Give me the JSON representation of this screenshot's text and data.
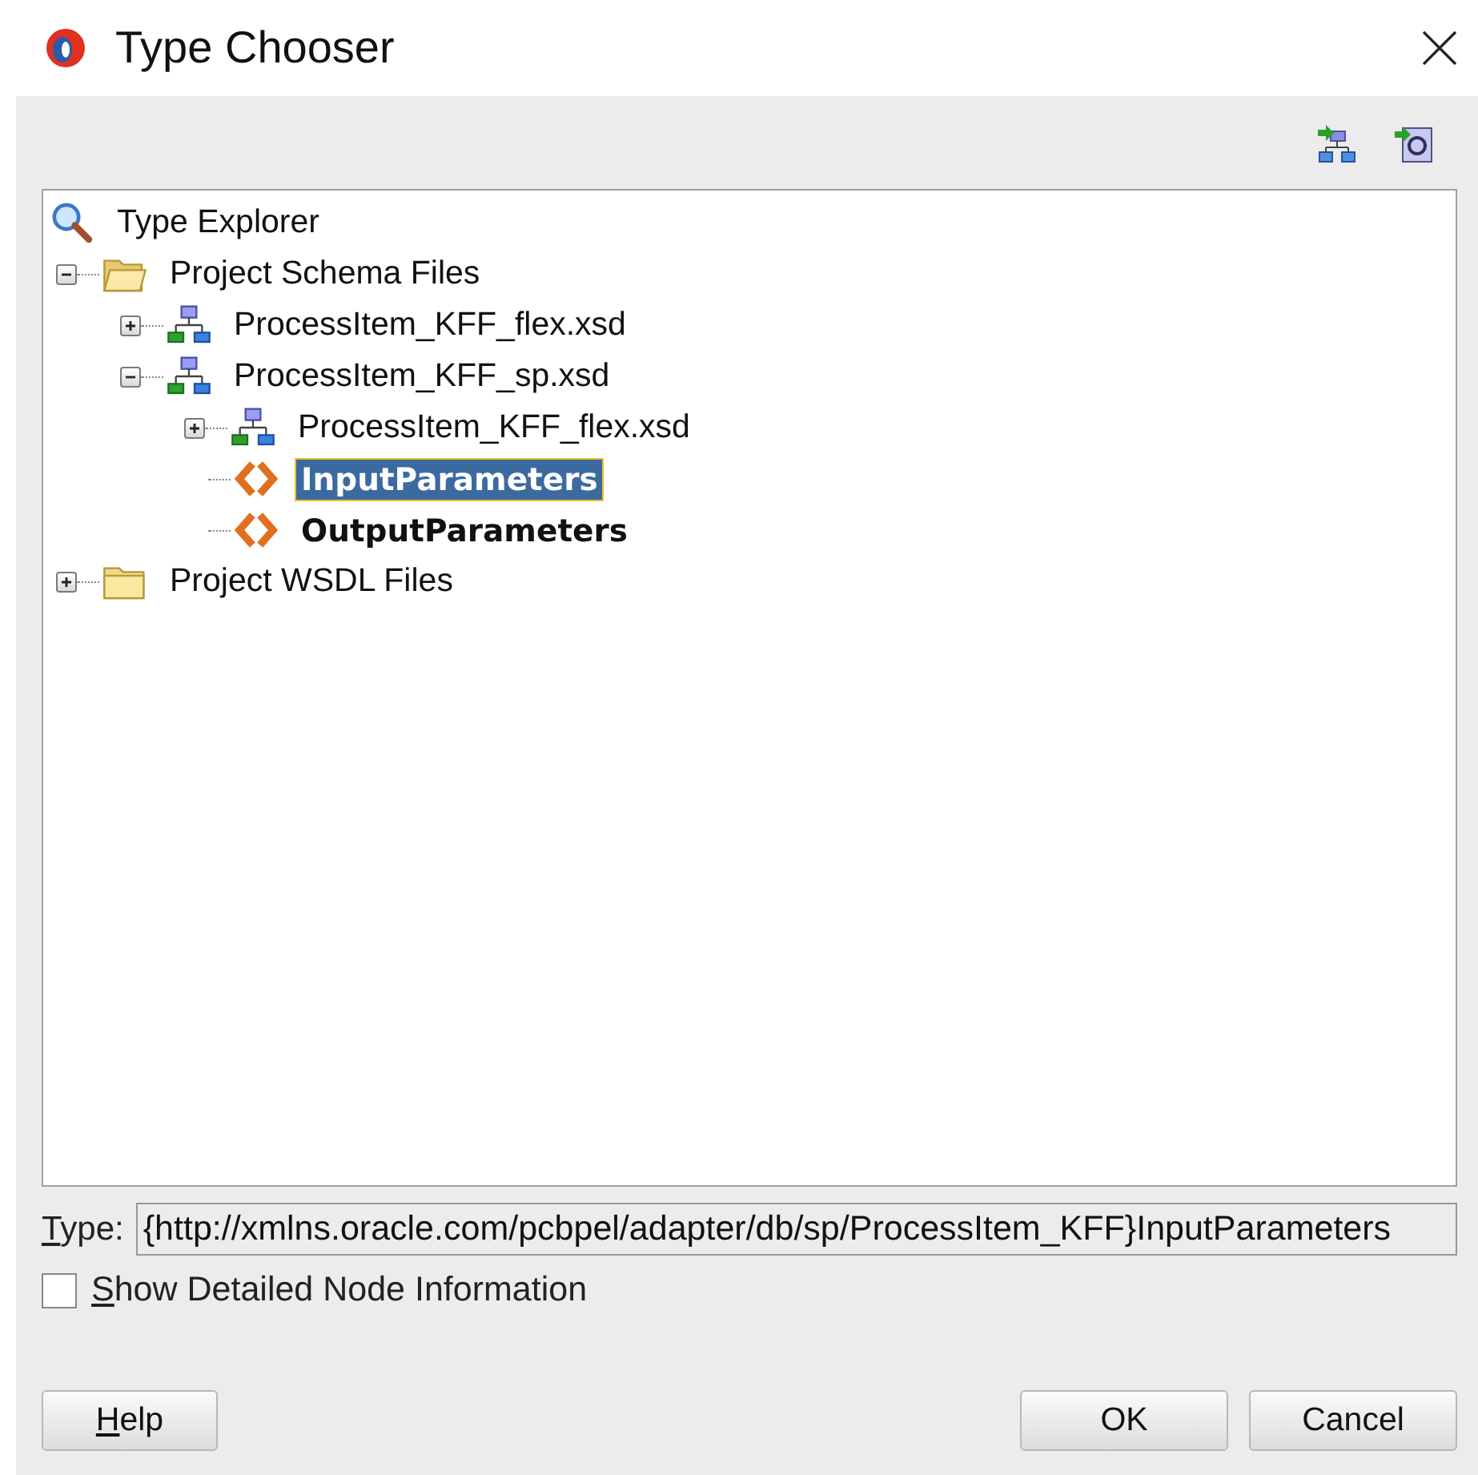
{
  "window": {
    "title": "Type Chooser"
  },
  "tree": [
    {
      "kind": "search",
      "label": "Type Explorer",
      "children": [
        {
          "kind": "folder",
          "label": "Project Schema Files",
          "expanded": true,
          "children": [
            {
              "kind": "schema",
              "label": "ProcessItem_KFF_flex.xsd",
              "expanded": false
            },
            {
              "kind": "schema",
              "label": "ProcessItem_KFF_sp.xsd",
              "expanded": true,
              "children": [
                {
                  "kind": "schema",
                  "label": "ProcessItem_KFF_flex.xsd",
                  "expanded": false
                },
                {
                  "kind": "element",
                  "label": "InputParameters",
                  "bold": true,
                  "selected": true
                },
                {
                  "kind": "element",
                  "label": "OutputParameters",
                  "bold": true,
                  "selected": false
                }
              ]
            }
          ]
        },
        {
          "kind": "folder",
          "label": "Project WSDL Files",
          "expanded": false
        }
      ]
    }
  ],
  "type_field": {
    "label": "Type:",
    "value": "{http://xmlns.oracle.com/pcbpel/adapter/db/sp/ProcessItem_KFF}InputParameters"
  },
  "detail_checkbox": {
    "label": "Show Detailed Node Information",
    "checked": false
  },
  "buttons": [
    {
      "label": "Help",
      "kind": "left"
    },
    {
      "label": "OK",
      "kind": "right"
    },
    {
      "label": "Cancel",
      "kind": "right"
    }
  ]
}
